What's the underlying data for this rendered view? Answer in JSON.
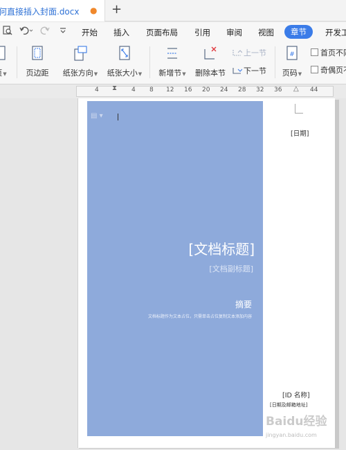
{
  "tabbar": {
    "doc_title": "何直接插入封面.docx",
    "unsaved_dot": "●",
    "new_tab": "+"
  },
  "menubar": {
    "items": [
      "开始",
      "插入",
      "页面布局",
      "引用",
      "审阅",
      "视图",
      "章节",
      "开发工"
    ],
    "active": "章节"
  },
  "ribbon": {
    "cover_partial": "页",
    "margins": "页边距",
    "orientation": "纸张方向",
    "size": "纸张大小",
    "new_section": "新增节",
    "delete_section": "删除本节",
    "prev_section": "上一节",
    "next_section": "下一节",
    "page_number": "页码",
    "first_page_diff": "首页不同",
    "odd_even_diff": "奇偶页不"
  },
  "ruler": {
    "ticks": [
      "4",
      "4",
      "8",
      "12",
      "16",
      "20",
      "24",
      "28",
      "32",
      "36",
      "44"
    ]
  },
  "cover": {
    "title": "[文档标题]",
    "subtitle": "[文档副标题]",
    "abstract_heading": "摘要",
    "abstract_body": "文档标题作为文本占位，只需单击占位复制文本添加内容",
    "date": "[日期]",
    "id_name": "[ID 名称]",
    "date_email": "[日期及邮箱地址]"
  },
  "watermark": {
    "brand": "Baidu经验",
    "url": "jingyan.baidu.com"
  },
  "colors": {
    "accent": "#3b7ce8",
    "tab_title": "#2f72d6",
    "unsaved": "#f0882c",
    "cover_panel": "#8eaadb"
  }
}
